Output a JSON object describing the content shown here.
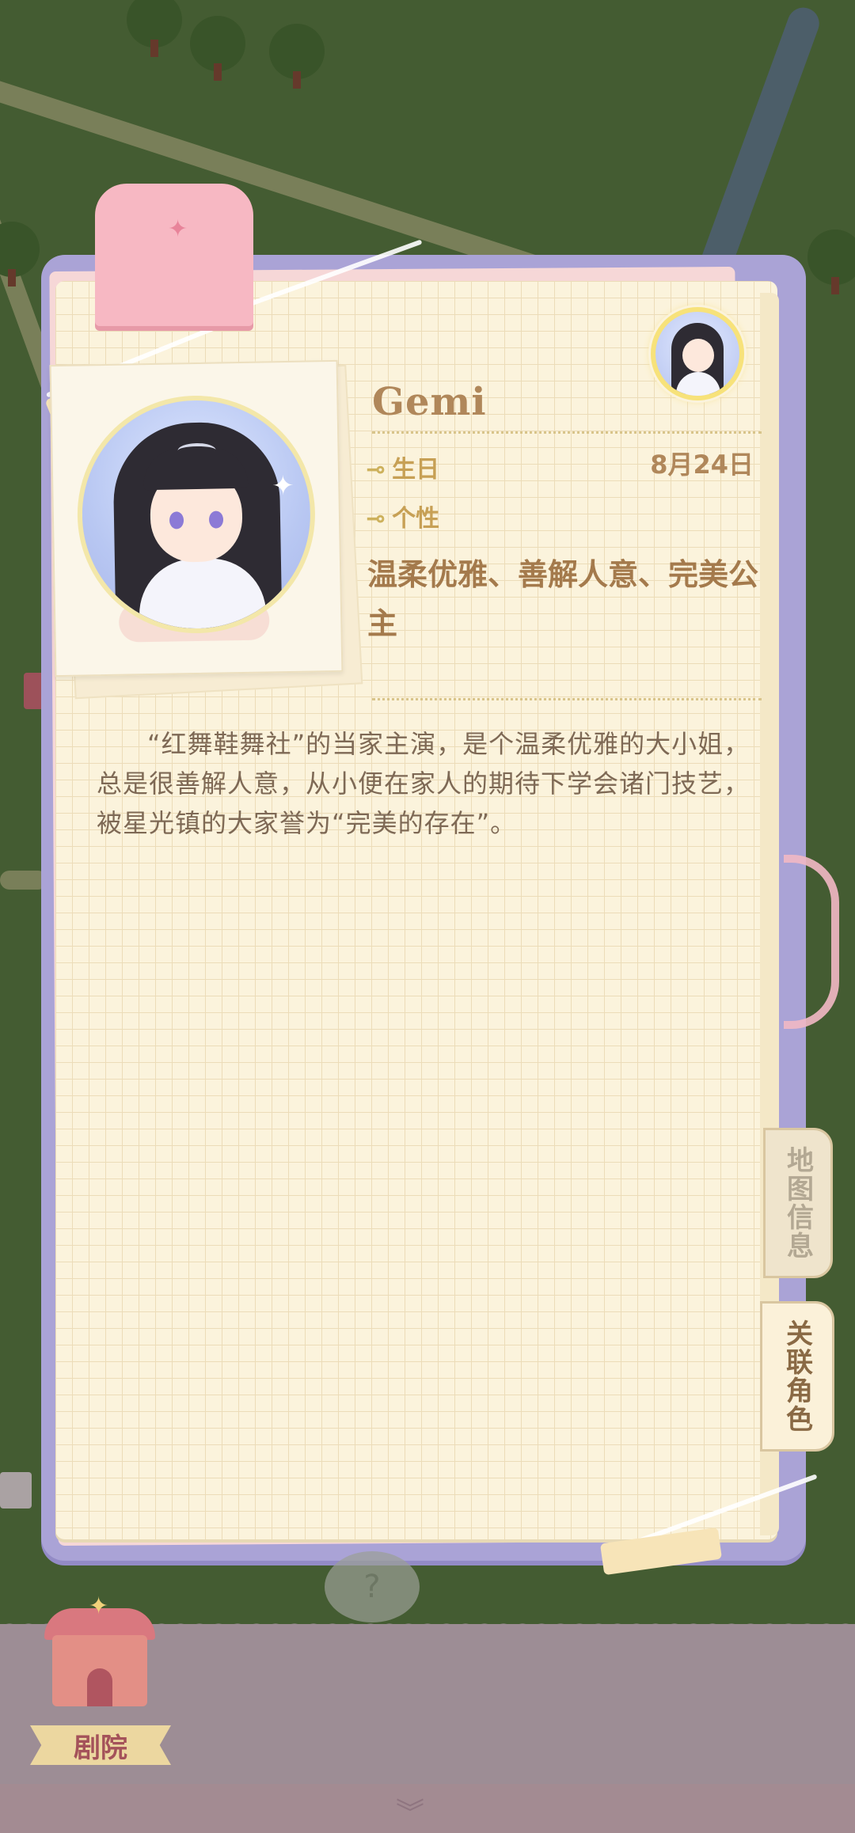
{
  "profile": {
    "name": "Gemi",
    "birthday_label": "生日",
    "birthday_value": "8月24日",
    "personality_label": "个性",
    "traits": "温柔优雅、善解人意、完美公主",
    "description": "“红舞鞋舞社”的当家主演，是个温柔优雅的大小姐，总是很善解人意，从小便在家人的期待下学会诸门技艺，被星光镇的大家誉为“完美的存在”。"
  },
  "side_tabs": {
    "map_info": "地图信息",
    "related_characters": "关联角色"
  },
  "bottom": {
    "location_label": "剧院"
  },
  "icons": {
    "field_arrow": "⊸",
    "question_mark": "?",
    "chevron_down": "︾"
  },
  "colors": {
    "paper": "#fbf3dc",
    "frame": "#aaa3d6",
    "accent_text": "#b0875a",
    "tag_pink": "#f7b8c3"
  }
}
